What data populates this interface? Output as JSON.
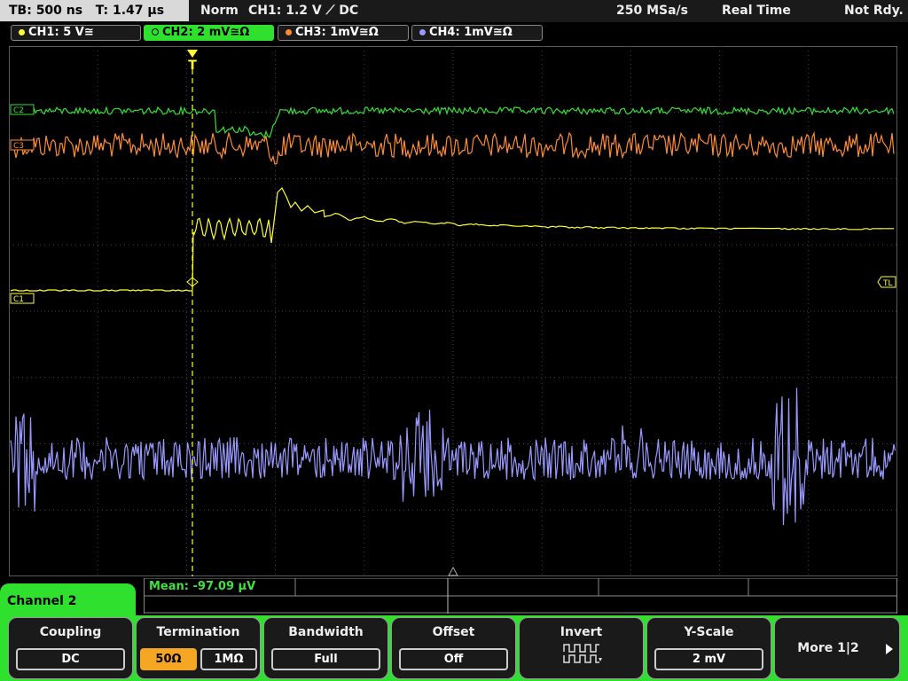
{
  "topbar": {
    "timebase": "TB: 500 ns",
    "trigger_time": "T: 1.47 µs",
    "mode": "Norm",
    "trigger": "CH1: 1.2 V ⟋ DC",
    "samplerate": "250 MSa/s",
    "acq": "Real Time",
    "status": "Not Rdy."
  },
  "channels": [
    {
      "label": "CH1: 5 V≅",
      "color": "#ffff33"
    },
    {
      "label": "CH2: 2 mV≅Ω",
      "color": "#33e033"
    },
    {
      "label": "CH3: 1mV≅Ω",
      "color": "#ff8c33"
    },
    {
      "label": "CH4: 1mV≅Ω",
      "color": "#9999ff"
    }
  ],
  "markers": {
    "ch2": "C2",
    "ch3": "C3",
    "ch1": "C1",
    "trigger_level": "TL",
    "trigger_pos": "T"
  },
  "measurement": {
    "mean": "Mean: -97.09 µV"
  },
  "menu": {
    "title": "Channel 2"
  },
  "softkeys": [
    {
      "title": "Coupling",
      "value": "DC"
    },
    {
      "title": "Termination",
      "value_a": "50Ω",
      "value_b": "1MΩ"
    },
    {
      "title": "Bandwidth",
      "value": "Full"
    },
    {
      "title": "Offset",
      "value": "Off"
    },
    {
      "title": "Invert",
      "icon": "invert-waveform-icon"
    },
    {
      "title": "Y-Scale",
      "value": "2 mV"
    },
    {
      "title": "More 1|2"
    }
  ]
}
